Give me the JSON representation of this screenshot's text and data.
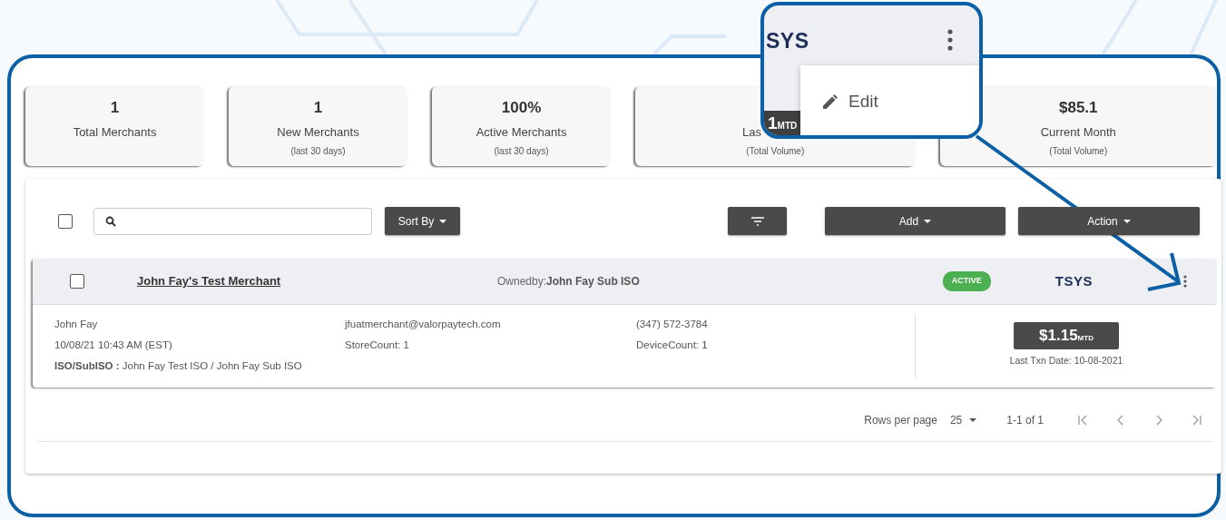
{
  "stats": [
    {
      "value": "1",
      "label": "Total Merchants"
    },
    {
      "value": "1",
      "label": "New Merchants",
      "sublabel": "(last 30 days)"
    },
    {
      "value": "100%",
      "label": "Active Merchants",
      "sublabel": "(last 30 days)"
    },
    {
      "label": "Las",
      "sublabel": "(Total Volume)"
    },
    {
      "value": "$85.1",
      "label": "Current Month",
      "sublabel": "(Total Volume)"
    }
  ],
  "toolbar": {
    "select_all_checked": false,
    "sort_button": "Sort By",
    "add_button": "Add",
    "action_button": "Action"
  },
  "merchants": [
    {
      "checked": false,
      "name": "John Fay's Test Merchant",
      "owned_by_label": "Ownedby:",
      "owned_by": "John Fay Sub ISO",
      "status": "ACTIVE",
      "color": "#4caf50",
      "processor": "TSYS",
      "contact": "John Fay",
      "created": "10/08/21 10:43 AM (EST)",
      "iso_label": "ISO/SubISO :",
      "iso": "John Fay Test ISO / John Fay Sub ISO",
      "email": "jfuatmerchant@valorpaytech.com",
      "store_count": "StoreCount: 1",
      "phone": "(347) 572-3784",
      "device_count_label": "DeviceCount:",
      "device_count": "1",
      "mtd_amount": "$1.15",
      "mtd_unit": "MTD",
      "last_txn": "Last Txn Date: 10-08-2021"
    }
  ],
  "pagination": {
    "rows_per_page_label": "Rows per page",
    "rows_per_page": "25",
    "range": "1-1 of 1"
  },
  "callout": {
    "logo_fragment": "SYS",
    "chip_value": "1",
    "chip_unit": "MTD",
    "menu_items": [
      {
        "label": "Edit"
      }
    ]
  }
}
